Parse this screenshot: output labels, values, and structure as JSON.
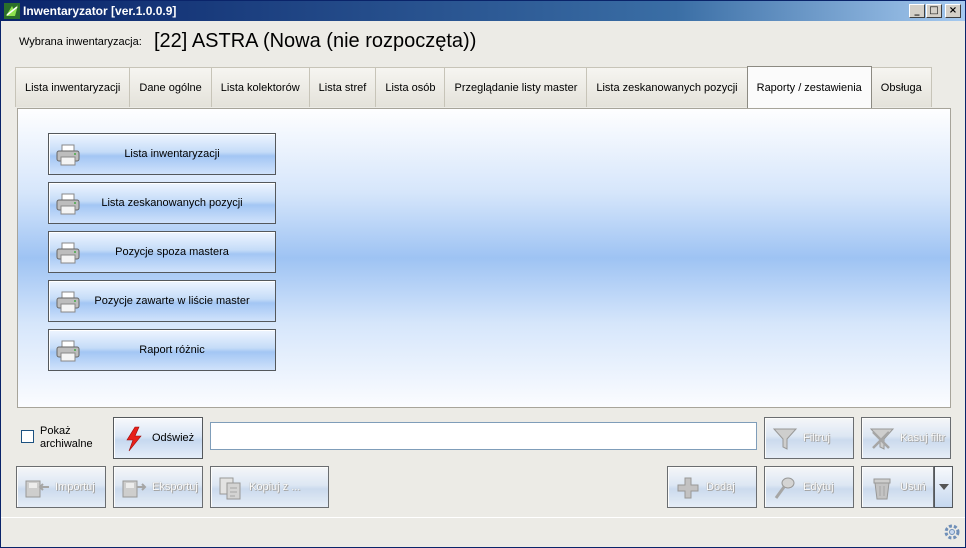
{
  "window": {
    "title": "Inwentaryzator [ver.1.0.0.9]",
    "minimize": "_",
    "maximize": "□",
    "close": "×"
  },
  "header": {
    "label": "Wybrana inwentaryzacja:",
    "value": "[22] ASTRA (Nowa (nie rozpoczęta))"
  },
  "tabs": [
    {
      "label": "Lista inwentaryzacji"
    },
    {
      "label": "Dane ogólne"
    },
    {
      "label": "Lista kolektorów"
    },
    {
      "label": "Lista stref"
    },
    {
      "label": "Lista osób"
    },
    {
      "label": "Przeglądanie listy master"
    },
    {
      "label": "Lista zeskanowanych pozycji"
    },
    {
      "label": "Raporty / zestawienia",
      "active": true
    },
    {
      "label": "Obsługa"
    }
  ],
  "reports": [
    {
      "label": "Lista inwentaryzacji",
      "icon": "printer-icon"
    },
    {
      "label": "Lista zeskanowanych pozycji",
      "icon": "printer-icon"
    },
    {
      "label": "Pozycje spoza mastera",
      "icon": "printer-icon"
    },
    {
      "label": "Pozycje zawarte w liście master",
      "icon": "printer-icon"
    },
    {
      "label": "Raport różnic",
      "icon": "printer-icon"
    }
  ],
  "toolbar": {
    "show_archived_label": "Pokaż archiwalne",
    "refresh_label": "Odśwież",
    "filter_value": "",
    "filter_label": "Filtruj",
    "clear_filter_label": "Kasuj filtr",
    "import_label": "Importuj",
    "export_label": "Eksportuj",
    "copy_label": "Kopiuj z ...",
    "add_label": "Dodaj",
    "edit_label": "Edytuj",
    "delete_label": "Usuń"
  },
  "colors": {
    "titlebar": "#0a246a",
    "panel_accent": "#9ec3f3",
    "refresh_icon": "#e8201a"
  }
}
